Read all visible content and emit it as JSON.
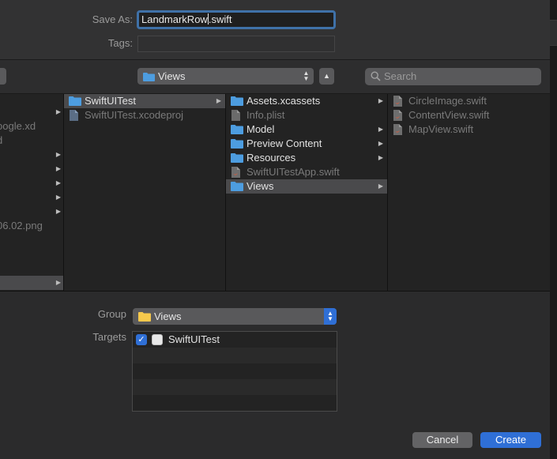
{
  "save_panel": {
    "save_as_label": "Save As:",
    "filename_before_cursor": "LandmarkRow",
    "filename_after_cursor": ".swift",
    "tags_label": "Tags:",
    "tags_value": ""
  },
  "toolbar": {
    "location_popup": "Views",
    "search_placeholder": "Search"
  },
  "browser": {
    "column0": [
      {
        "name": "",
        "arrow": true
      },
      {
        "name": "oogle.xd",
        "arrow": false
      },
      {
        "name": "d",
        "arrow": false
      },
      {
        "name": "",
        "arrow": true
      },
      {
        "name": "",
        "arrow": true
      },
      {
        "name": "",
        "arrow": true
      },
      {
        "name": "",
        "arrow": true
      },
      {
        "name": "",
        "arrow": true
      },
      {
        "name": "06.02.png",
        "arrow": false
      }
    ],
    "column1": [
      {
        "name": "SwiftUITest",
        "kind": "folder",
        "selected": true,
        "dim": false,
        "arrow": true
      },
      {
        "name": "SwiftUITest.xcodeproj",
        "kind": "file",
        "selected": false,
        "dim": true,
        "arrow": false
      }
    ],
    "column2": [
      {
        "name": "Assets.xcassets",
        "kind": "folder",
        "selected": false,
        "dim": false,
        "arrow": true
      },
      {
        "name": "Info.plist",
        "kind": "file",
        "selected": false,
        "dim": true,
        "arrow": false
      },
      {
        "name": "Model",
        "kind": "folder",
        "selected": false,
        "dim": false,
        "arrow": true
      },
      {
        "name": "Preview Content",
        "kind": "folder",
        "selected": false,
        "dim": false,
        "arrow": true
      },
      {
        "name": "Resources",
        "kind": "folder",
        "selected": false,
        "dim": false,
        "arrow": true
      },
      {
        "name": "SwiftUITestApp.swift",
        "kind": "swift",
        "selected": false,
        "dim": true,
        "arrow": false
      },
      {
        "name": "Views",
        "kind": "folder",
        "selected": true,
        "dim": false,
        "arrow": true
      }
    ],
    "column3": [
      {
        "name": "CircleImage.swift",
        "kind": "swift",
        "dim": true
      },
      {
        "name": "ContentView.swift",
        "kind": "swift",
        "dim": true
      },
      {
        "name": "MapView.swift",
        "kind": "swift",
        "dim": true
      }
    ]
  },
  "options": {
    "group_label": "Group",
    "group_value": "Views",
    "targets_label": "Targets",
    "targets": [
      {
        "name": "SwiftUITest",
        "checked": true
      }
    ]
  },
  "buttons": {
    "cancel": "Cancel",
    "create": "Create"
  },
  "colors": {
    "accent": "#2f6fd6",
    "folder": "#4d9de0",
    "group_folder": "#f5c84c"
  }
}
